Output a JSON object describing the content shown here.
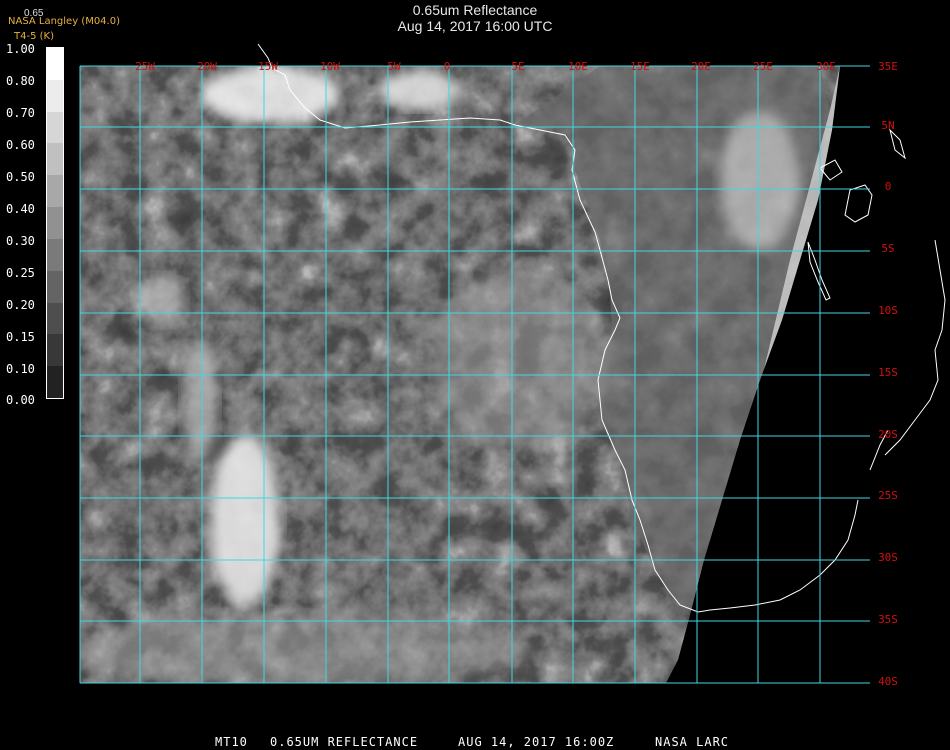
{
  "header": {
    "title": "0.65um Reflectance",
    "subtitle": "Aug 14, 2017 16:00 UTC",
    "provider": "NASA Langley (M04.0)",
    "channel": "T4-5 (K)",
    "corner_value": "0.65"
  },
  "colorbar": {
    "labels": [
      "1.00",
      "0.80",
      "0.70",
      "0.60",
      "0.50",
      "0.40",
      "0.30",
      "0.25",
      "0.20",
      "0.15",
      "0.10",
      "0.00"
    ],
    "shades": [
      "#ffffff",
      "#ececec",
      "#d6d6d6",
      "#c0c0c0",
      "#a8a8a8",
      "#919191",
      "#7a7a7a",
      "#646464",
      "#4e4e4e",
      "#383838",
      "#222222"
    ]
  },
  "map": {
    "lon_labels": [
      "25W",
      "20W",
      "15W",
      "10W",
      "5W",
      "0",
      "5E",
      "10E",
      "15E",
      "20E",
      "25E",
      "30E"
    ],
    "lat_labels": [
      "35E",
      "5N",
      "0",
      "5S",
      "10S",
      "15S",
      "20S",
      "25S",
      "30S",
      "35S",
      "40S"
    ],
    "grid_color": "#3fd9e0",
    "label_color": "#d01010",
    "coast_color": "#ffffff"
  },
  "footer": {
    "product": "MT10",
    "band": "0.65UM REFLECTANCE",
    "datetime": "AUG 14, 2017 16:00Z",
    "source": "NASA LARC"
  }
}
